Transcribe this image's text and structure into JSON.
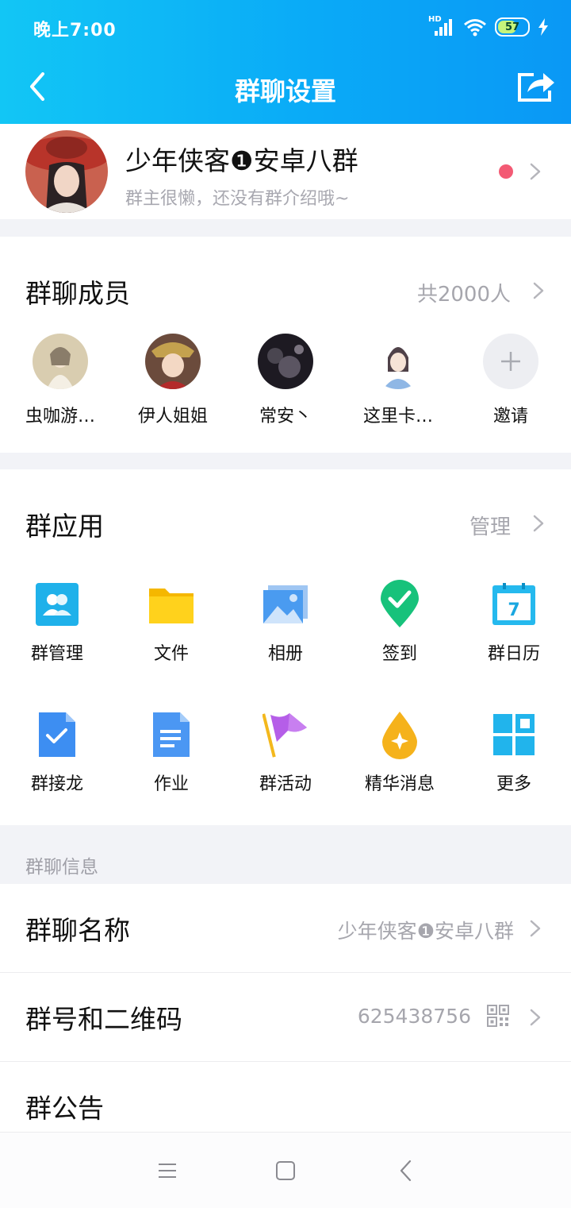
{
  "status_bar": {
    "time": "晚上7:00",
    "network_label": "HD",
    "battery_level": "57"
  },
  "header": {
    "title": "群聊设置"
  },
  "group": {
    "name": "少年侠客❶安卓八群",
    "description": "群主很懒，还没有群介绍哦~"
  },
  "members": {
    "title": "群聊成员",
    "count_label": "共2000人",
    "items": [
      {
        "name": "虫咖游…"
      },
      {
        "name": "伊人姐姐"
      },
      {
        "name": "常安丶"
      },
      {
        "name": "这里卡…"
      }
    ],
    "invite_label": "邀请"
  },
  "apps": {
    "title": "群应用",
    "manage_label": "管理",
    "items": [
      {
        "label": "群管理",
        "icon": "group-manage-icon"
      },
      {
        "label": "文件",
        "icon": "folder-icon"
      },
      {
        "label": "相册",
        "icon": "album-icon"
      },
      {
        "label": "签到",
        "icon": "checkin-icon"
      },
      {
        "label": "群日历",
        "icon": "calendar-icon",
        "calendar_day": "7"
      },
      {
        "label": "群接龙",
        "icon": "relay-icon"
      },
      {
        "label": "作业",
        "icon": "homework-icon"
      },
      {
        "label": "群活动",
        "icon": "flag-icon"
      },
      {
        "label": "精华消息",
        "icon": "essence-icon"
      },
      {
        "label": "更多",
        "icon": "more-grid-icon"
      }
    ]
  },
  "info": {
    "section_label": "群聊信息",
    "rows": [
      {
        "label": "群聊名称",
        "value": "少年侠客❶安卓八群"
      },
      {
        "label": "群号和二维码",
        "value": "625438756"
      },
      {
        "label": "群公告",
        "value": ""
      }
    ]
  },
  "colors": {
    "header_start": "#12c6f5",
    "header_end": "#0a98f5",
    "accent_dot": "#f35a74",
    "secondary_text": "#a6a6ad"
  }
}
